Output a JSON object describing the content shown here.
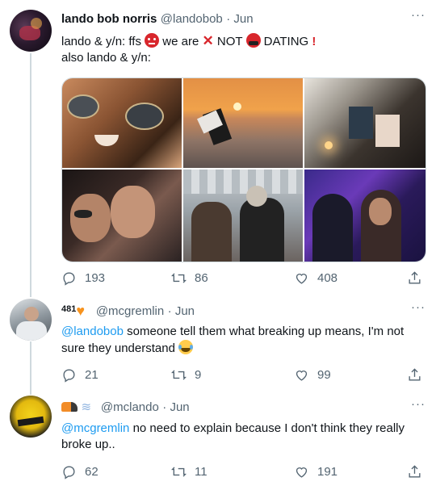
{
  "tweets": [
    {
      "display_name": "lando bob norris",
      "handle": "@landobob",
      "time": "· Jun",
      "line1_a": "lando & y/n: ffs",
      "line1_b": "we are",
      "line1_c": "NOT",
      "line1_d": "DATING",
      "line2": "also lando & y/n:",
      "replies": "193",
      "retweets": "86",
      "likes": "408"
    },
    {
      "display_name": "481",
      "handle": "@mcgremlin",
      "time": "· Jun",
      "mention": "@landobob",
      "text": " someone tell them what breaking up means, I'm not sure they understand",
      "replies": "21",
      "retweets": "9",
      "likes": "99"
    },
    {
      "handle": "@mclando",
      "time": "· Jun",
      "mention": "@mcgremlin",
      "text_a": " no need to explain because I don't think they really",
      "text_b": "broke up..",
      "replies": "62",
      "retweets": "11",
      "likes": "191"
    }
  ],
  "colors": {
    "link": "#1d9bf0",
    "secondary": "#536471",
    "thread_line": "#cfd9de",
    "heart_badge": "#f7931e"
  },
  "icons": [
    "reply-icon",
    "retweet-icon",
    "like-icon",
    "share-icon",
    "more-icon"
  ]
}
